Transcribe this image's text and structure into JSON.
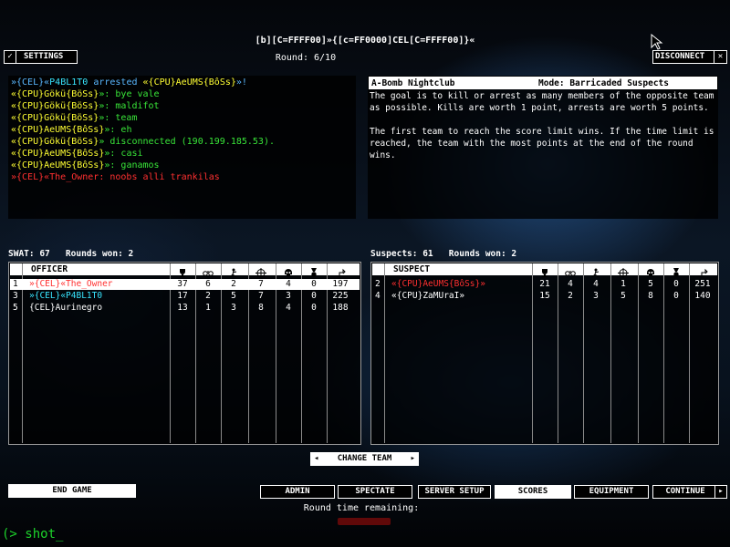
{
  "header": {
    "title": "[b][C=FFFF00]»{[c=FF0000]CEL[C=FFFF00]}«",
    "round": "Round: 6/10",
    "settings_label": "SETTINGS",
    "disconnect_label": "DISCONNECT"
  },
  "chat": [
    {
      "parts": [
        {
          "t": "»{CEL}«",
          "c": "#5ab8ff"
        },
        {
          "t": "P4BL1T0",
          "c": "#39e6ff"
        },
        {
          "t": " arrested ",
          "c": "#5ab8ff"
        },
        {
          "t": "«{CPU}AeUMS{BôSs}",
          "c": "#ffff33"
        },
        {
          "t": "»!",
          "c": "#5ab8ff"
        }
      ]
    },
    {
      "parts": [
        {
          "t": "«{CPU}",
          "c": "#ffff33"
        },
        {
          "t": "Gökü{BöSs}",
          "c": "#ffff33"
        },
        {
          "t": "»: bye vale",
          "c": "#39e639"
        }
      ]
    },
    {
      "parts": [
        {
          "t": "«{CPU}Gökü{BöSs}",
          "c": "#ffff33"
        },
        {
          "t": "»: maldifot",
          "c": "#39e639"
        }
      ]
    },
    {
      "parts": [
        {
          "t": "«{CPU}Gökü{BöSs}",
          "c": "#ffff33"
        },
        {
          "t": "»: team",
          "c": "#39e639"
        }
      ]
    },
    {
      "parts": [
        {
          "t": "«{CPU}AeUMS{BôSs}",
          "c": "#ffff33"
        },
        {
          "t": "»: eh",
          "c": "#39e639"
        }
      ]
    },
    {
      "parts": [
        {
          "t": "«{CPU}Gökü{BöSs}",
          "c": "#ffff33"
        },
        {
          "t": "» disconnected (190.199.185.53).",
          "c": "#39e639"
        }
      ]
    },
    {
      "parts": [
        {
          "t": "«{CPU}AeUMS{BôSs}",
          "c": "#ffff33"
        },
        {
          "t": "»: casi",
          "c": "#39e639"
        }
      ]
    },
    {
      "parts": [
        {
          "t": "«{CPU}AeUMS{BôSs}",
          "c": "#ffff33"
        },
        {
          "t": "»: ganamos",
          "c": "#39e639"
        }
      ]
    },
    {
      "parts": [
        {
          "t": "»{CEL}«The_Owner",
          "c": "#ff3030"
        },
        {
          "t": ": noobs alli trankilas",
          "c": "#ff3030"
        }
      ]
    }
  ],
  "mission": {
    "map": "A-Bomb Nightclub",
    "mode": "Mode: Barricaded Suspects",
    "desc1": "The goal is to kill or arrest as many members of the opposite team as possible.  Kills are worth 1 point, arrests are worth 5 points.",
    "desc2": "The first team to reach the score limit wins.  If the time limit is reached, the team with the most points at the end of the round wins."
  },
  "swat": {
    "summary": "SWAT: 67   Rounds won: 2",
    "header": "OFFICER",
    "rows": [
      {
        "id": "1",
        "name": "»{CEL}«The_Owner",
        "color": "#ff3030",
        "selected": true,
        "stats": [
          "37",
          "6",
          "2",
          "7",
          "4",
          "0",
          "197"
        ]
      },
      {
        "id": "3",
        "name": "»{CEL}«P4BL1T0",
        "color": "#39e6ff",
        "selected": false,
        "stats": [
          "17",
          "2",
          "5",
          "7",
          "3",
          "0",
          "225"
        ]
      },
      {
        "id": "5",
        "name": "{CEL}Aurinegro",
        "color": "#ffffff",
        "selected": false,
        "stats": [
          "13",
          "1",
          "3",
          "8",
          "4",
          "0",
          "188"
        ]
      }
    ]
  },
  "suspects": {
    "summary": "Suspects: 61   Rounds won: 2",
    "header": "SUSPECT",
    "rows": [
      {
        "id": "2",
        "name": "«{CPU}AeUMS{BôSs}»",
        "color": "#ff3030",
        "selected": false,
        "stats": [
          "21",
          "4",
          "4",
          "1",
          "5",
          "0",
          "251"
        ]
      },
      {
        "id": "4",
        "name": "«{CPU}ZaMUraI»",
        "color": "#ffffff",
        "selected": false,
        "stats": [
          "15",
          "2",
          "3",
          "5",
          "8",
          "0",
          "140"
        ]
      }
    ]
  },
  "stat_icons": [
    "trophy-icon",
    "handcuffs-icon",
    "arrest-icon",
    "crosshair-icon",
    "skull-icon",
    "medal-icon",
    "ping-icon"
  ],
  "buttons": {
    "change_team": "CHANGE TEAM",
    "end_game": "END GAME",
    "admin": "ADMIN",
    "spectate": "SPECTATE",
    "server_setup": "SERVER SETUP",
    "scores": "SCORES",
    "equipment": "EQUIPMENT",
    "continue": "CONTINUE"
  },
  "footer": {
    "round_time_label": "Round time remaining:",
    "console": "(> shot_"
  }
}
